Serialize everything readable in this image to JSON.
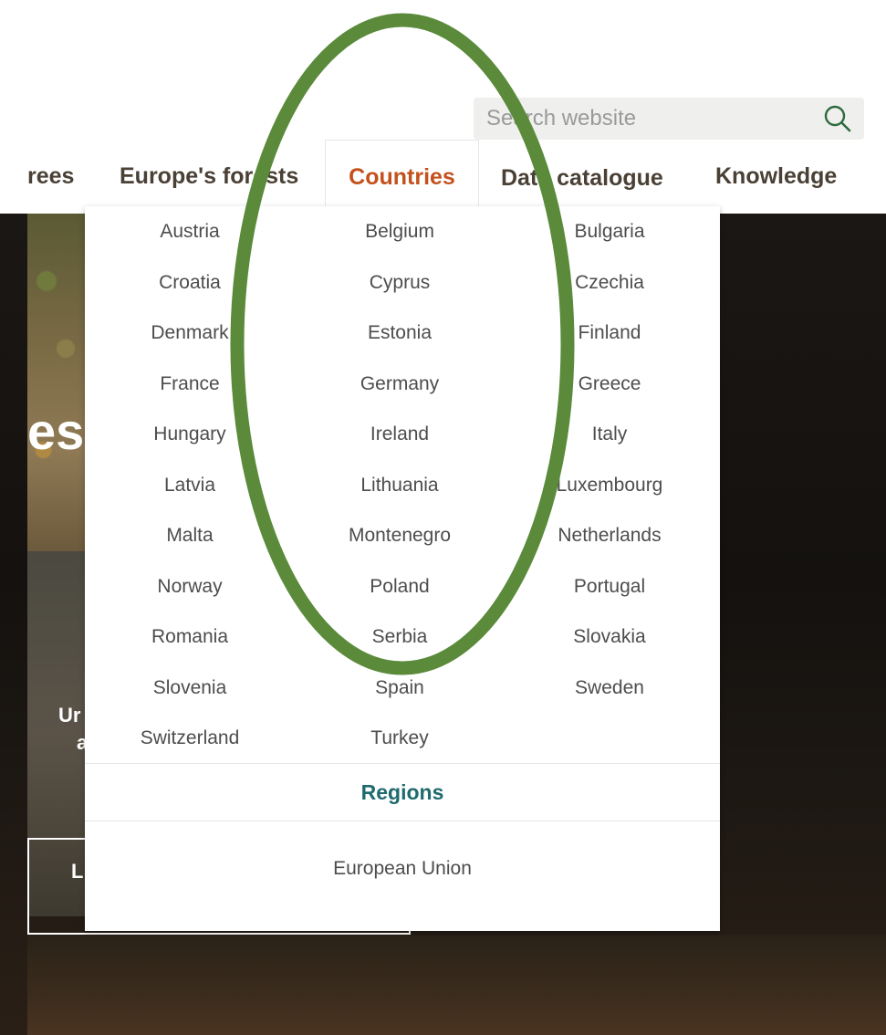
{
  "search": {
    "placeholder": "Search website"
  },
  "nav": {
    "items": [
      {
        "label": "rees"
      },
      {
        "label": "Europe's forests"
      },
      {
        "label": "Countries"
      },
      {
        "label": "Data catalogue"
      },
      {
        "label": "Knowledge"
      }
    ]
  },
  "dropdown": {
    "countries": [
      "Austria",
      "Belgium",
      "Bulgaria",
      "Croatia",
      "Cyprus",
      "Czechia",
      "Denmark",
      "Estonia",
      "Finland",
      "France",
      "Germany",
      "Greece",
      "Hungary",
      "Ireland",
      "Italy",
      "Latvia",
      "Lithuania",
      "Luxembourg",
      "Malta",
      "Montenegro",
      "Netherlands",
      "Norway",
      "Poland",
      "Portugal",
      "Romania",
      "Serbia",
      "Slovakia",
      "Slovenia",
      "Spain",
      "Sweden",
      "Switzerland",
      "Turkey"
    ],
    "regions_title": "Regions",
    "regions": [
      "European Union"
    ]
  },
  "hero": {
    "title_fragment": "es",
    "sub_fragment_1": "Ur",
    "sub_fragment_2": "a",
    "button_fragment": "L"
  },
  "colors": {
    "active_nav": "#c4511d",
    "regions_title": "#1f6a6e",
    "annotation_ellipse": "#5a8a3a"
  },
  "icons": {
    "search": "search-icon"
  }
}
